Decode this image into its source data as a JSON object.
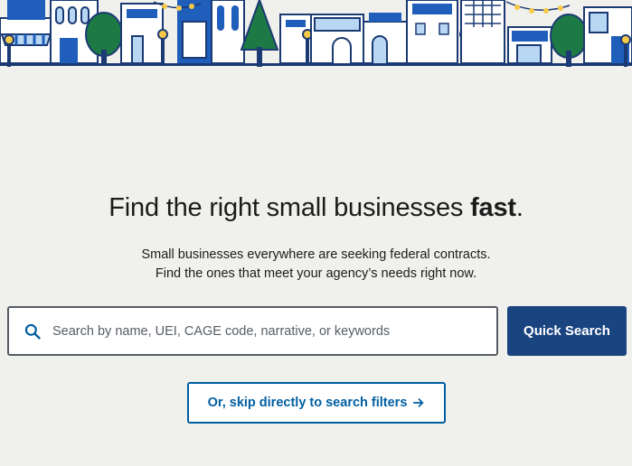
{
  "hero": {
    "headline_lead": "Find the right small businesses ",
    "headline_emphasis": "fast",
    "headline_trail": ".",
    "subtext_line1": "Small businesses everywhere are seeking federal contracts.",
    "subtext_line2": "Find the ones that meet your agency’s needs right now."
  },
  "search": {
    "placeholder": "Search by name, UEI, CAGE code, narrative, or keywords",
    "value": "",
    "button_label": "Quick Search"
  },
  "skip": {
    "label": "Or, skip directly to search filters"
  },
  "icons": {
    "search": "search-icon",
    "skip_arrow": "arrow-right-icon"
  },
  "colors": {
    "background": "#f0f0ec",
    "primary_dark": "#1a4480",
    "primary": "#005ea2",
    "illustration_blue": "#1f5ebb",
    "illustration_light_blue": "#b8d7f2",
    "tree_green": "#1e7a44",
    "lamp_yellow": "#f7c948"
  }
}
